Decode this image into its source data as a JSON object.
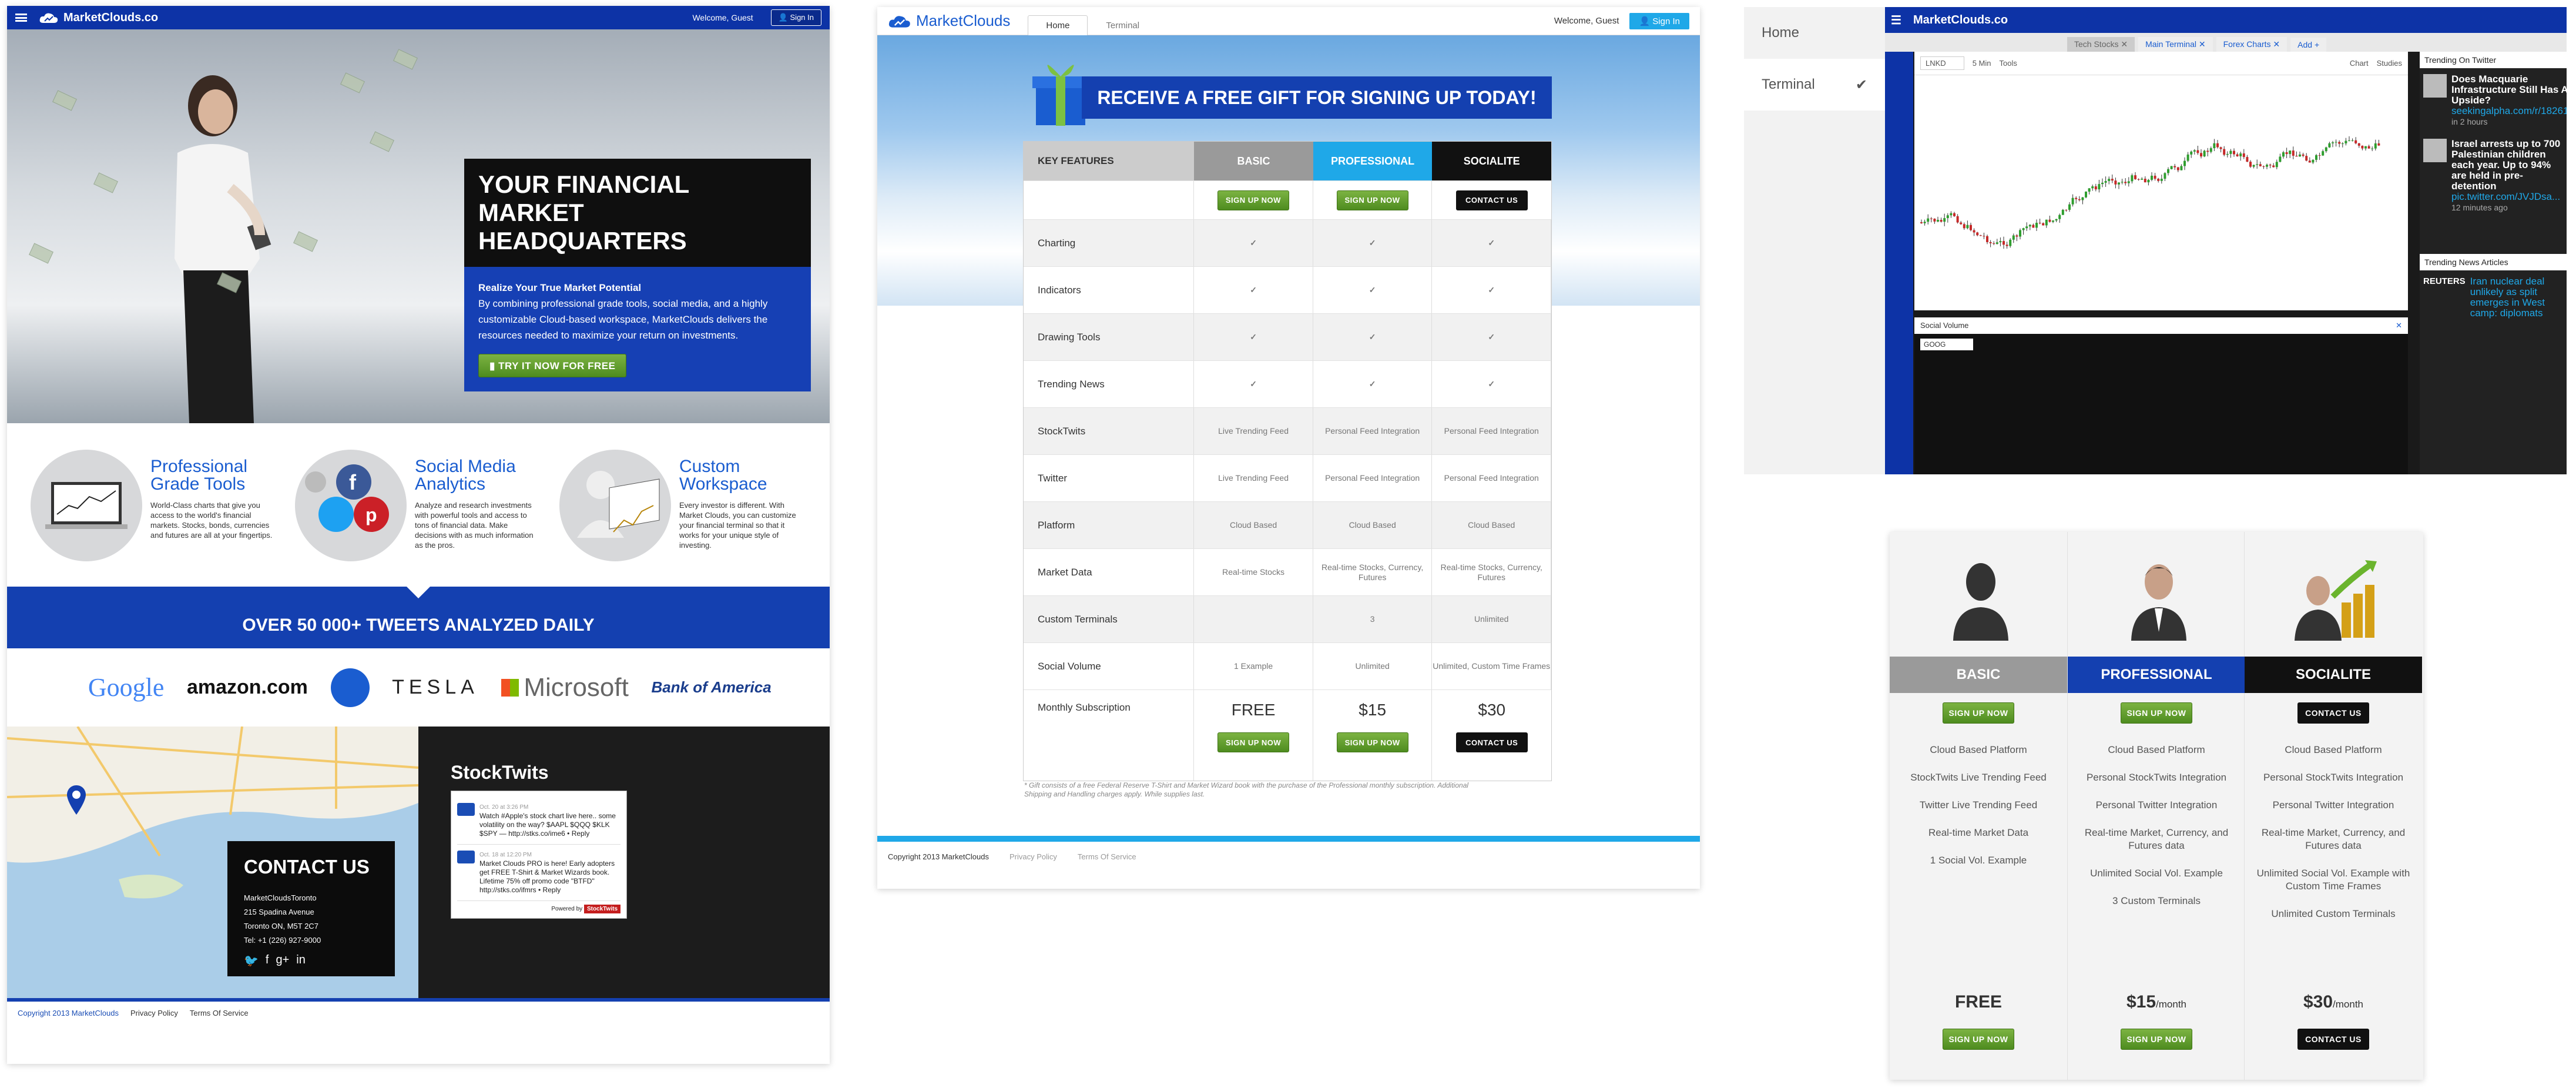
{
  "p1": {
    "logo": "MarketClouds.co",
    "welcome": "Welcome, Guest",
    "sign_in": "Sign In",
    "hero_title": "YOUR FINANCIAL MARKET HEADQUARTERS",
    "hero_sub": "Realize Your True Market Potential",
    "hero_body": "By combining professional grade tools, social media, and a highly customizable Cloud-based workspace, MarketClouds delivers the resources needed to maximize your return on investments.",
    "hero_cta": "TRY IT NOW FOR FREE",
    "features": [
      {
        "title": "Professional Grade Tools",
        "body": "World-Class charts that give you access to the world's financial markets. Stocks, bonds, currencies and futures are all at your fingertips."
      },
      {
        "title": "Social Media Analytics",
        "body": "Analyze and research investments with powerful tools and access to tons of financial data. Make decisions with as much information as the pros."
      },
      {
        "title": "Custom Workspace",
        "body": "Every investor is different. With Market Clouds, you can customize your financial terminal so that it works for your unique style of investing."
      }
    ],
    "tweets_band": "OVER 50 000+ TWEETS ANALYZED DAILY",
    "brands": [
      "Google",
      "amazon.com",
      "TESLA",
      "Microsoft",
      "Bank of America"
    ],
    "contact_title": "CONTACT US",
    "contact_lines": [
      "MarketCloudsToronto",
      "215 Spadina Avenue",
      "Toronto ON, M5T 2C7",
      "Tel: +1 (226) 927-9000"
    ],
    "stocktwits_title": "StockTwits",
    "st_items": [
      {
        "meta": "Oct. 20 at 3:26 PM",
        "text": "Watch #Apple's stock chart live here.. some volatility on the way? $AAPL $QQQ $KLK $SPY — http://stks.co/ime6 • Reply"
      },
      {
        "meta": "Oct. 18 at 12:20 PM",
        "text": "Market Clouds PRO is here! Early adopters get FREE T-Shirt & Market Wizards book. Lifetime 75% off promo code \"BTFD\" http://stks.co/ifmrs • Reply"
      }
    ],
    "st_powered": "Powered by",
    "st_brand": "StockTwits",
    "footer": [
      "Copyright 2013 MarketClouds",
      "Privacy Policy",
      "Terms Of Service"
    ]
  },
  "p2": {
    "logo": "MarketClouds",
    "tabs": [
      "Home",
      "Terminal"
    ],
    "welcome": "Welcome, Guest",
    "sign_in": "Sign In",
    "banner": "RECEIVE A FREE GIFT FOR SIGNING UP TODAY!",
    "head": [
      "KEY FEATURES",
      "BASIC",
      "PROFESSIONAL",
      "SOCIALITE"
    ],
    "head_colors": [
      "#9a9a9a",
      "#1fa8e8",
      "#111111"
    ],
    "btn_labels": [
      "SIGN UP NOW",
      "SIGN UP NOW",
      "CONTACT US"
    ],
    "rows": [
      {
        "label": "Charting",
        "vals": [
          "✓",
          "✓",
          "✓"
        ]
      },
      {
        "label": "Indicators",
        "vals": [
          "✓",
          "✓",
          "✓"
        ]
      },
      {
        "label": "Drawing Tools",
        "vals": [
          "✓",
          "✓",
          "✓"
        ]
      },
      {
        "label": "Trending News",
        "vals": [
          "✓",
          "✓",
          "✓"
        ]
      },
      {
        "label": "StockTwits",
        "vals": [
          "Live Trending Feed",
          "Personal Feed Integration",
          "Personal Feed Integration"
        ]
      },
      {
        "label": "Twitter",
        "vals": [
          "Live Trending Feed",
          "Personal Feed Integration",
          "Personal Feed Integration"
        ]
      },
      {
        "label": "Platform",
        "vals": [
          "Cloud Based",
          "Cloud Based",
          "Cloud Based"
        ]
      },
      {
        "label": "Market Data",
        "vals": [
          "Real-time Stocks",
          "Real-time Stocks, Currency, Futures",
          "Real-time Stocks, Currency, Futures"
        ]
      },
      {
        "label": "Custom Terminals",
        "vals": [
          "",
          "3",
          "Unlimited"
        ]
      },
      {
        "label": "Social Volume",
        "vals": [
          "1 Example",
          "Unlimited",
          "Unlimited, Custom Time Frames"
        ]
      }
    ],
    "sub_label": "Monthly Subscription",
    "prices": [
      "FREE",
      "$15",
      "$30"
    ],
    "note": "* Gift consists of a free Federal Reserve T-Shirt and Market Wizard book with the purchase of the Professional monthly subscription. Additional Shipping and Handling charges apply. While supplies last.",
    "footer": [
      "Copyright 2013 MarketClouds",
      "Privacy Policy",
      "Terms Of Service"
    ]
  },
  "p3": {
    "side": [
      "Home",
      "Terminal"
    ],
    "logo": "MarketClouds.co",
    "tabs": [
      "Tech Stocks",
      "Main Terminal",
      "Forex Charts",
      "Add"
    ],
    "symbol": "LNKD",
    "interval": "5 Min",
    "tools": "Tools",
    "chart_btn": "Chart",
    "studies": "Studies",
    "social_title": "Social Volume",
    "social_symbol": "GOOG",
    "trend_title": "Trending On Twitter",
    "tweets": [
      {
        "text": "Does Macquarie Infrastructure Still Has An Upside?",
        "link": "seekingalpha.com/r/18261...",
        "meta": "in 2 hours"
      },
      {
        "text": "Israel arrests up to 700 Palestinian children each year. Up to 94% are held in pre-detention",
        "link": "pic.twitter.com/JVJDsa...",
        "meta": "12 minutes ago"
      }
    ],
    "news_title": "Trending News Articles",
    "news_src": "REUTERS",
    "news_text": "Iran nuclear deal unlikely as split emerges in West camp: diplomats"
  },
  "p4": {
    "cols": [
      {
        "name": "BASIC",
        "color": "#9a9a9a",
        "btn": "SIGN UP NOW",
        "items": [
          "Cloud Based Platform",
          "StockTwits Live Trending Feed",
          "Twitter Live Trending Feed",
          "Real-time Market Data",
          "1 Social Vol. Example"
        ],
        "price": "FREE",
        "per": ""
      },
      {
        "name": "PROFESSIONAL",
        "color": "#1440b0",
        "btn": "SIGN UP NOW",
        "items": [
          "Cloud Based Platform",
          "Personal StockTwits Integration",
          "Personal Twitter Integration",
          "Real-time Market, Currency, and Futures data",
          "Unlimited Social Vol. Example",
          "3 Custom Terminals"
        ],
        "price": "$15",
        "per": "/month"
      },
      {
        "name": "SOCIALITE",
        "color": "#111111",
        "btn": "CONTACT US",
        "items": [
          "Cloud Based Platform",
          "Personal StockTwits Integration",
          "Personal Twitter Integration",
          "Real-time Market, Currency, and Futures data",
          "Unlimited Social Vol. Example with Custom Time Frames",
          "Unlimited Custom Terminals"
        ],
        "price": "$30",
        "per": "/month"
      }
    ]
  }
}
